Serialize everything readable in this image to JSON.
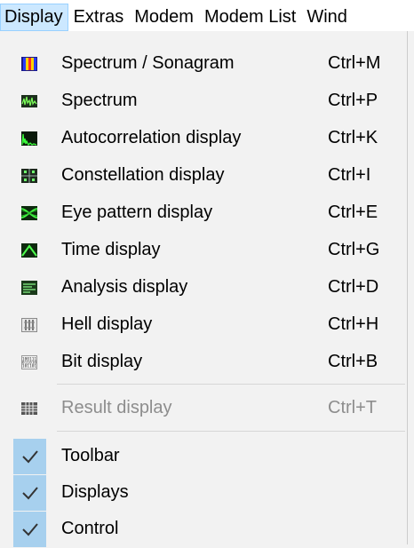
{
  "menubar": {
    "items": [
      "Display",
      "Extras",
      "Modem",
      "Modem List",
      "Wind"
    ]
  },
  "menu": {
    "items": [
      {
        "label": "Spectrum / Sonagram",
        "shortcut": "Ctrl+M",
        "icon": "spectrum-sonagram-icon"
      },
      {
        "label": "Spectrum",
        "shortcut": "Ctrl+P",
        "icon": "spectrum-icon"
      },
      {
        "label": "Autocorrelation display",
        "shortcut": "Ctrl+K",
        "icon": "autocorrelation-icon"
      },
      {
        "label": "Constellation display",
        "shortcut": "Ctrl+I",
        "icon": "constellation-icon"
      },
      {
        "label": "Eye pattern display",
        "shortcut": "Ctrl+E",
        "icon": "eye-pattern-icon"
      },
      {
        "label": "Time display",
        "shortcut": "Ctrl+G",
        "icon": "time-display-icon"
      },
      {
        "label": "Analysis display",
        "shortcut": "Ctrl+D",
        "icon": "analysis-icon"
      },
      {
        "label": "Hell display",
        "shortcut": "Ctrl+H",
        "icon": "hell-display-icon"
      },
      {
        "label": "Bit display",
        "shortcut": "Ctrl+B",
        "icon": "bit-display-icon"
      },
      {
        "label": "Result display",
        "shortcut": "Ctrl+T",
        "icon": "result-display-icon",
        "disabled": true
      }
    ],
    "toggles": [
      {
        "label": "Toolbar",
        "checked": true
      },
      {
        "label": "Displays",
        "checked": true
      },
      {
        "label": "Control",
        "checked": true
      }
    ]
  },
  "colors": {
    "menu_bg": "#f2f2f2",
    "active_bg": "#cce8ff",
    "check_bg": "#a7d0ee",
    "disabled_text": "#8d8d8d"
  }
}
